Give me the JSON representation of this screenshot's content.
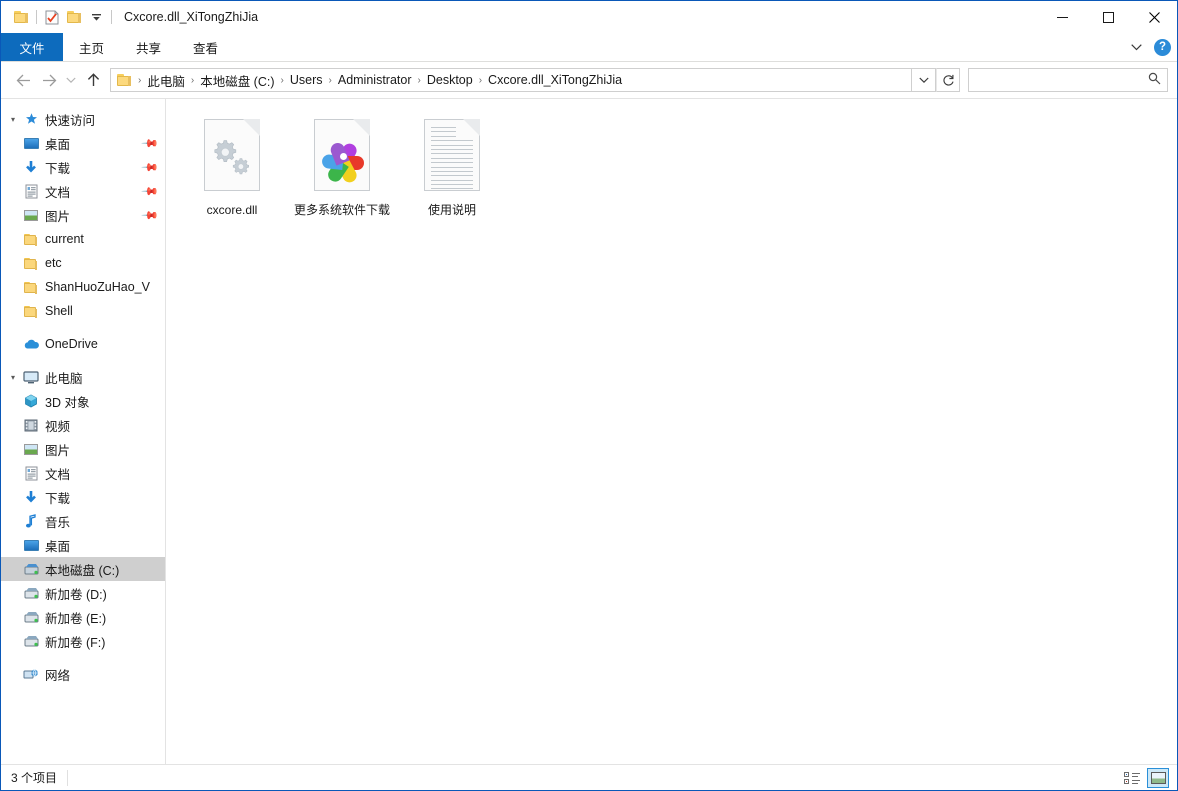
{
  "window": {
    "title": "Cxcore.dll_XiTongZhiJia",
    "quick_access_toolbar": [
      {
        "name": "folder-icon",
        "label": ""
      },
      {
        "name": "properties-icon",
        "label": ""
      },
      {
        "name": "new-folder-icon",
        "label": ""
      },
      {
        "name": "customize-dropdown-icon",
        "label": "▾"
      }
    ],
    "controls": {
      "minimize": "—",
      "maximize": "☐",
      "close": "✕"
    },
    "accent_color": "#0a58b8"
  },
  "ribbon": {
    "tabs": [
      {
        "label": "文件",
        "active": true
      },
      {
        "label": "主页",
        "active": false
      },
      {
        "label": "共享",
        "active": false
      },
      {
        "label": "查看",
        "active": false
      }
    ],
    "expand_icon": "⌄",
    "help_label": "?"
  },
  "addressbar": {
    "back_icon": "←",
    "forward_icon": "→",
    "recent_icon": "⌄",
    "up_icon": "↑",
    "breadcrumb": [
      "此电脑",
      "本地磁盘 (C:)",
      "Users",
      "Administrator",
      "Desktop",
      "Cxcore.dll_XiTongZhiJia"
    ],
    "separator": "›",
    "dropdown_icon": "⌄",
    "refresh_icon": "↻",
    "search": {
      "value": "",
      "placeholder": "",
      "icon": "search-icon"
    }
  },
  "sidebar": {
    "groups": [
      {
        "header": {
          "label": "快速访问",
          "icon": "pin-star-icon",
          "expanded": true
        },
        "items": [
          {
            "label": "桌面",
            "icon": "desktop-icon",
            "pinned": true
          },
          {
            "label": "下载",
            "icon": "downloads-icon",
            "pinned": true
          },
          {
            "label": "文档",
            "icon": "documents-icon",
            "pinned": true
          },
          {
            "label": "图片",
            "icon": "pictures-icon",
            "pinned": true
          },
          {
            "label": "current",
            "icon": "folder-icon",
            "pinned": false
          },
          {
            "label": "etc",
            "icon": "folder-icon",
            "pinned": false
          },
          {
            "label": "ShanHuoZuHao_V",
            "icon": "folder-icon",
            "pinned": false
          },
          {
            "label": "Shell",
            "icon": "folder-icon",
            "pinned": false
          }
        ]
      },
      {
        "header": {
          "label": "OneDrive",
          "icon": "cloud-icon",
          "expanded": false
        },
        "items": []
      },
      {
        "header": {
          "label": "此电脑",
          "icon": "this-pc-icon",
          "expanded": true
        },
        "items": [
          {
            "label": "3D 对象",
            "icon": "3d-objects-icon",
            "pinned": false
          },
          {
            "label": "视频",
            "icon": "videos-icon",
            "pinned": false
          },
          {
            "label": "图片",
            "icon": "pictures-icon",
            "pinned": false
          },
          {
            "label": "文档",
            "icon": "documents-icon",
            "pinned": false
          },
          {
            "label": "下载",
            "icon": "downloads-icon",
            "pinned": false
          },
          {
            "label": "音乐",
            "icon": "music-icon",
            "pinned": false
          },
          {
            "label": "桌面",
            "icon": "desktop-icon",
            "pinned": false
          },
          {
            "label": "本地磁盘 (C:)",
            "icon": "system-drive-icon",
            "pinned": false,
            "selected": true
          },
          {
            "label": "新加卷 (D:)",
            "icon": "drive-icon",
            "pinned": false
          },
          {
            "label": "新加卷 (E:)",
            "icon": "drive-icon",
            "pinned": false
          },
          {
            "label": "新加卷 (F:)",
            "icon": "drive-icon",
            "pinned": false
          }
        ]
      },
      {
        "header": {
          "label": "网络",
          "icon": "network-icon",
          "expanded": false
        },
        "items": []
      }
    ]
  },
  "content": {
    "files": [
      {
        "name": "cxcore.dll",
        "icon": "dll-gears-icon"
      },
      {
        "name": "更多系统软件下载",
        "icon": "pinwheel-browser-icon"
      },
      {
        "name": "使用说明",
        "icon": "text-document-icon"
      }
    ]
  },
  "statusbar": {
    "item_count": "3 个项目",
    "views": [
      {
        "name": "details-view",
        "active": false
      },
      {
        "name": "large-icons-view",
        "active": true
      }
    ]
  }
}
